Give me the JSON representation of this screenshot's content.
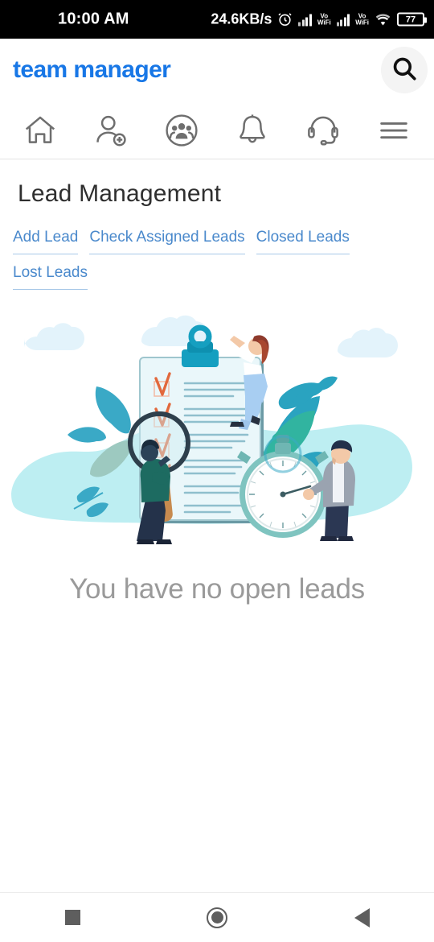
{
  "status_bar": {
    "time": "10:00 AM",
    "network_speed": "24.6KB/s",
    "volte_label_1": "Vo",
    "volte_sub_1": "WiFi",
    "volte_label_2": "Vo",
    "volte_sub_2": "WiFi",
    "battery_level": "77",
    "icons": [
      "alarm-icon",
      "signal-bars-icon",
      "volte-wifi-icon",
      "signal-bars-icon",
      "volte-wifi-icon",
      "wifi-icon",
      "battery-icon"
    ]
  },
  "app_bar": {
    "logo_text": "team manager",
    "logo_color": "#1877e6",
    "search_icon": "search-icon"
  },
  "icon_nav": {
    "items": [
      {
        "name": "home",
        "icon": "home-icon"
      },
      {
        "name": "add-user",
        "icon": "person-add-icon"
      },
      {
        "name": "team",
        "icon": "group-circle-icon"
      },
      {
        "name": "notifications",
        "icon": "bell-icon"
      },
      {
        "name": "support",
        "icon": "headset-icon"
      },
      {
        "name": "menu",
        "icon": "hamburger-menu-icon"
      }
    ]
  },
  "main": {
    "page_title": "Lead Management",
    "tabs": [
      {
        "label": "Add Lead"
      },
      {
        "label": "Check Assigned Leads"
      },
      {
        "label": "Closed Leads"
      },
      {
        "label": "Lost Leads"
      }
    ],
    "tab_color": "#4a89cc",
    "illustration": "lead-management-illustration",
    "empty_message": "You have no open leads",
    "empty_message_color": "#9a9a9a"
  },
  "android_nav": {
    "recents": "recents-square-icon",
    "home": "home-circle-icon",
    "back": "back-triangle-icon"
  },
  "colors": {
    "accent_blue": "#1877e6",
    "link_blue": "#4a89cc",
    "illustration_blob": "#bdeef2",
    "illustration_teal": "#1c95b5",
    "cloud": "#e3f3fb"
  }
}
